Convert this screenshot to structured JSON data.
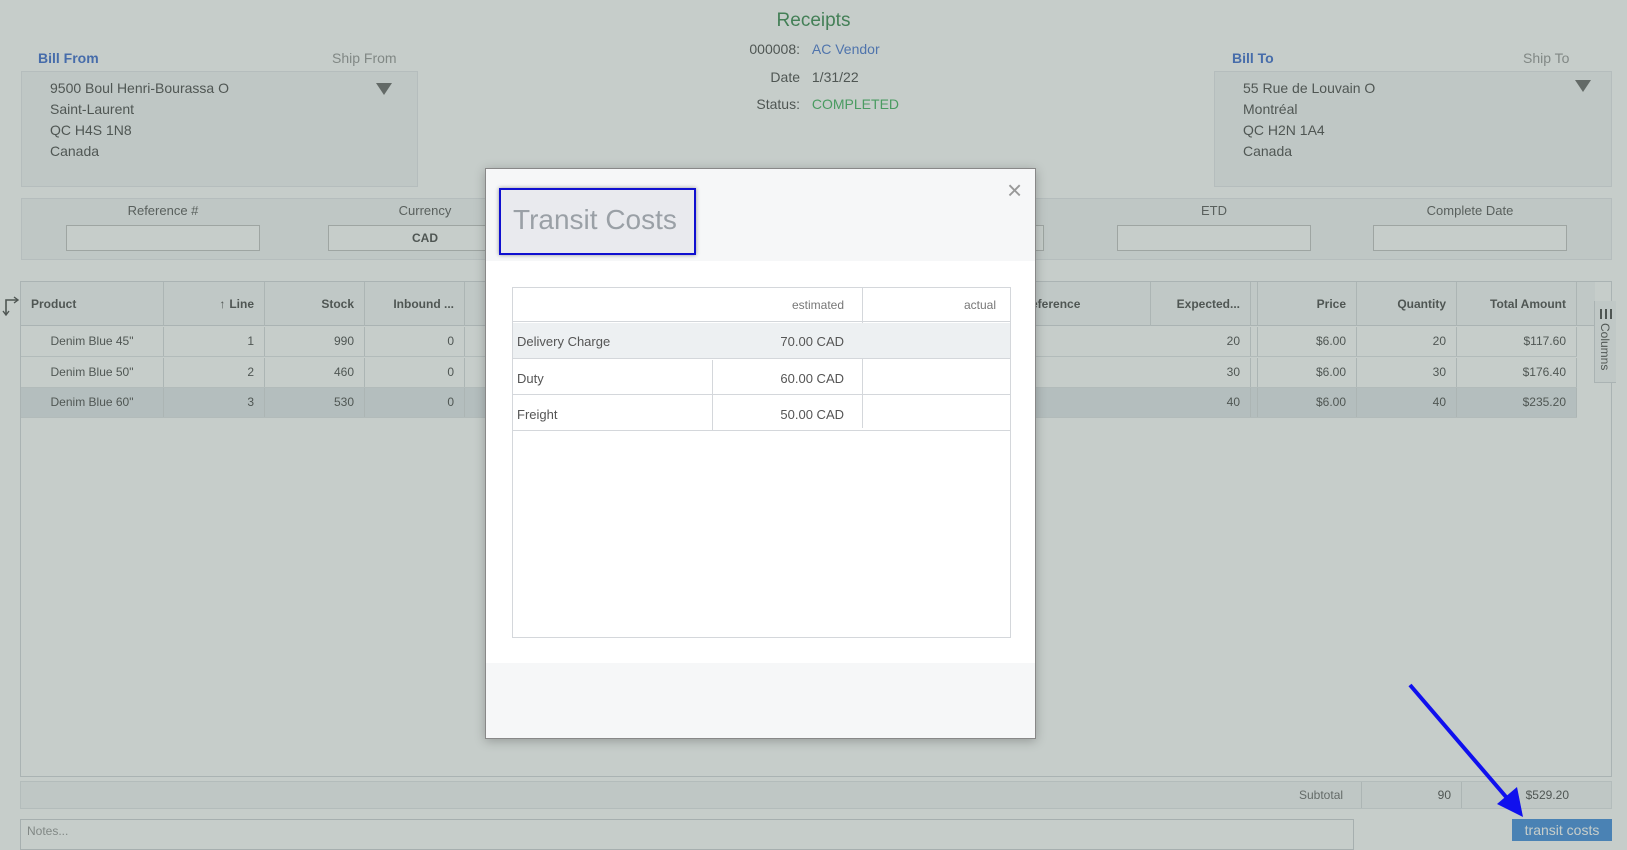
{
  "header": {
    "title": "Receipts",
    "doc_number_label": "000008:",
    "vendor": "AC Vendor",
    "date_label": "Date",
    "date_value": "1/31/22",
    "status_label": "Status:",
    "status_value": "COMPLETED"
  },
  "bill_from": {
    "tab_bill_from": "Bill From",
    "tab_ship_from": "Ship From",
    "lines": [
      "9500 Boul Henri-Bourassa O",
      "Saint-Laurent",
      "QC H4S 1N8",
      "Canada"
    ]
  },
  "bill_to": {
    "tab_bill_to": "Bill To",
    "tab_ship_to": "Ship To",
    "lines": [
      "55 Rue de Louvain O",
      "Montréal",
      "QC H2N 1A4",
      "Canada"
    ]
  },
  "fields": {
    "reference_label": "Reference #",
    "reference_value": "",
    "currency_label": "Currency",
    "currency_value": "CAD",
    "etd_label": "ETD",
    "etd_value": "",
    "complete_date_label": "Complete Date",
    "complete_date_value": ""
  },
  "grid": {
    "columns": {
      "product": "Product",
      "line": "Line",
      "stock": "Stock",
      "inbound": "Inbound ...",
      "reference": "eference",
      "expected": "Expected...",
      "price": "Price",
      "quantity": "Quantity",
      "total": "Total Amount"
    },
    "rows": [
      {
        "product": "Denim Blue 45\"",
        "line": "1",
        "stock": "990",
        "inbound": "0",
        "expected": "20",
        "price": "$6.00",
        "quantity": "20",
        "total": "$117.60"
      },
      {
        "product": "Denim Blue 50\"",
        "line": "2",
        "stock": "460",
        "inbound": "0",
        "expected": "30",
        "price": "$6.00",
        "quantity": "30",
        "total": "$176.40"
      },
      {
        "product": "Denim Blue 60\"",
        "line": "3",
        "stock": "530",
        "inbound": "0",
        "expected": "40",
        "price": "$6.00",
        "quantity": "40",
        "total": "$235.20"
      }
    ],
    "columns_tab": "Columns"
  },
  "footer": {
    "subtotal_label": "Subtotal",
    "subtotal_quantity": "90",
    "subtotal_amount": "$529.20",
    "notes_placeholder": "Notes...",
    "transit_costs_button": "transit costs"
  },
  "modal": {
    "title": "Transit Costs",
    "close_glyph": "×",
    "col_estimated": "estimated",
    "col_actual": "actual",
    "rows": [
      {
        "name": "Delivery Charge",
        "estimated": "70.00 CAD",
        "actual": ""
      },
      {
        "name": "Duty",
        "estimated": "60.00 CAD",
        "actual": ""
      },
      {
        "name": "Freight",
        "estimated": "50.00 CAD",
        "actual": ""
      }
    ]
  },
  "colors": {
    "title_green": "#1f7a3a",
    "status_green": "#2aa94a",
    "link_blue": "#2358c9",
    "button_blue": "#2a7fd9",
    "highlight_box": "#1010d0",
    "arrow_blue": "#1010ee"
  }
}
